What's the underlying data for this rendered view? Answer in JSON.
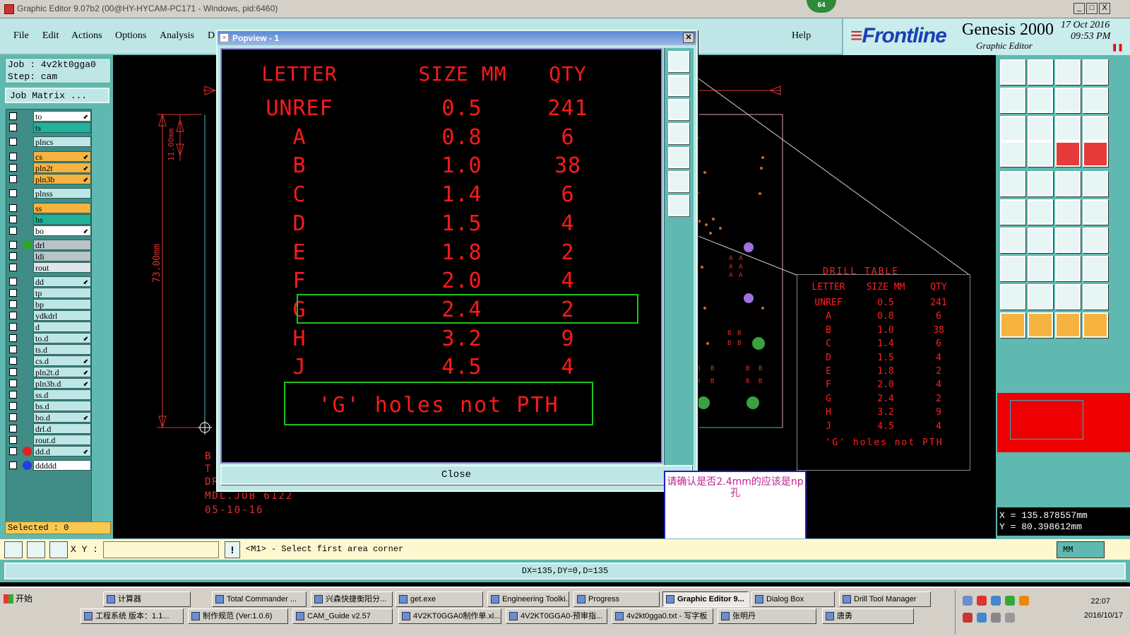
{
  "window": {
    "title": "Graphic Editor 9.07b2 (00@HY-HYCAM-PC171 - Windows, pid:6460)",
    "badge": "64",
    "min": "_",
    "max": "□",
    "close": "X"
  },
  "menu": {
    "items": [
      "File",
      "Edit",
      "Actions",
      "Options",
      "Analysis",
      "D"
    ],
    "help": "Help"
  },
  "brand": {
    "logo": "Frontline",
    "product": "Genesis 2000",
    "subtitle": "Graphic Editor",
    "date": "17 Oct 2016",
    "time": "09:53 PM"
  },
  "job": {
    "job_line": "Job : 4v2kt0gga0",
    "step_line": "Step: cam",
    "matrix_label": "Job Matrix ..."
  },
  "layers": [
    {
      "name": "to",
      "color": "#ffffff",
      "arrow": true
    },
    {
      "name": "ts",
      "color": "#1fb39b",
      "arrow": false
    },
    {
      "name": "plncs",
      "color": "#bfe6e6",
      "arrow": false
    },
    {
      "name": "cs",
      "color": "#f6b340",
      "arrow": true
    },
    {
      "name": "pln2t",
      "color": "#f6b340",
      "arrow": true
    },
    {
      "name": "pln3b",
      "color": "#f6b340",
      "arrow": true
    },
    {
      "name": "plnss",
      "color": "#bfe6e6",
      "arrow": false
    },
    {
      "name": "ss",
      "color": "#f6b340",
      "arrow": false
    },
    {
      "name": "bs",
      "color": "#1fb39b",
      "arrow": false
    },
    {
      "name": "bo",
      "color": "#ffffff",
      "arrow": true
    },
    {
      "name": "drl",
      "color": "#b8c4c8",
      "arrow": false,
      "dot": "#2aa62a"
    },
    {
      "name": "ldi",
      "color": "#b8c4c8",
      "arrow": false
    },
    {
      "name": "rout",
      "color": "#dfe6e8",
      "arrow": false
    },
    {
      "name": "dd",
      "color": "#bfe6e6",
      "arrow": true
    },
    {
      "name": "tp",
      "color": "#bfe6e6",
      "arrow": false
    },
    {
      "name": "bp",
      "color": "#bfe6e6",
      "arrow": false
    },
    {
      "name": "ydkdrl",
      "color": "#bfe6e6",
      "arrow": false
    },
    {
      "name": "d",
      "color": "#bfe6e6",
      "arrow": false
    },
    {
      "name": "to.d",
      "color": "#bfe6e6",
      "arrow": true
    },
    {
      "name": "ts.d",
      "color": "#bfe6e6",
      "arrow": false
    },
    {
      "name": "cs.d",
      "color": "#bfe6e6",
      "arrow": true
    },
    {
      "name": "pln2t.d",
      "color": "#bfe6e6",
      "arrow": true
    },
    {
      "name": "pln3b.d",
      "color": "#bfe6e6",
      "arrow": true
    },
    {
      "name": "ss.d",
      "color": "#bfe6e6",
      "arrow": false
    },
    {
      "name": "bs.d",
      "color": "#bfe6e6",
      "arrow": false
    },
    {
      "name": "bo.d",
      "color": "#bfe6e6",
      "arrow": true
    },
    {
      "name": "drl.d",
      "color": "#bfe6e6",
      "arrow": false
    },
    {
      "name": "rout.d",
      "color": "#bfe6e6",
      "arrow": false
    },
    {
      "name": "dd.d",
      "color": "#bfe6e6",
      "arrow": true,
      "dot": "#e02020"
    },
    {
      "name": "ddddd",
      "color": "#ffffff",
      "arrow": false,
      "dot": "#2040e0"
    }
  ],
  "selected": "Selected : 0",
  "popview": {
    "title": "Popview - 1",
    "close_label": "Close",
    "header": {
      "letter": "LETTER",
      "size": "SIZE MM",
      "qty": "QTY"
    },
    "rows": [
      {
        "letter": "UNREF",
        "size": "0.5",
        "qty": "241"
      },
      {
        "letter": "A",
        "size": "0.8",
        "qty": "6"
      },
      {
        "letter": "B",
        "size": "1.0",
        "qty": "38"
      },
      {
        "letter": "C",
        "size": "1.4",
        "qty": "6"
      },
      {
        "letter": "D",
        "size": "1.5",
        "qty": "4"
      },
      {
        "letter": "E",
        "size": "1.8",
        "qty": "2"
      },
      {
        "letter": "F",
        "size": "2.0",
        "qty": "4"
      },
      {
        "letter": "G",
        "size": "2.4",
        "qty": "2"
      },
      {
        "letter": "H",
        "size": "3.2",
        "qty": "9"
      },
      {
        "letter": "J",
        "size": "4.5",
        "qty": "4"
      }
    ],
    "highlight_letter": "G",
    "note": "'G' holes not PTH"
  },
  "canvas": {
    "dim_vertical": "73.00mm",
    "dim_small": "11.00mm",
    "labels_left": [
      "B",
      "T",
      "DRILL DRAWING",
      "MDL.JOB 6122",
      "05-10-16"
    ],
    "mini_table_title": "DRILL TABLE"
  },
  "comment": {
    "text": "请确认是否2.4mm的应该是np孔"
  },
  "coords": {
    "x": "X = 135.878557mm",
    "y": "Y = 80.398612mm"
  },
  "cmd": {
    "xy_label": "X Y :",
    "xy_value": "",
    "message": "<M1> - Select first area corner",
    "units": "MM",
    "warn": "!"
  },
  "status": "DX=135,DY=0,D=135",
  "taskbar": {
    "start": "开始",
    "row1": [
      "计算器",
      "Total Commander ...",
      "兴森快捷衡阳分...",
      "get.exe",
      "Engineering Toolki...",
      "Progress",
      "Graphic Editor 9...",
      "Dialog Box",
      "Drill Tool Manager"
    ],
    "row2": [
      "工程系统  版本：1.1...",
      "制作规范 (Ver:1.0.6)",
      "CAM_Guide v2.57",
      "4V2KT0GGA0制作单.xl...",
      "4V2KT0GGA0-预审指...",
      "4v2kt0gga0.txt - 写字板",
      "张明丹",
      "唐勇"
    ],
    "clock": "22:07",
    "date": "2016/10/17"
  }
}
